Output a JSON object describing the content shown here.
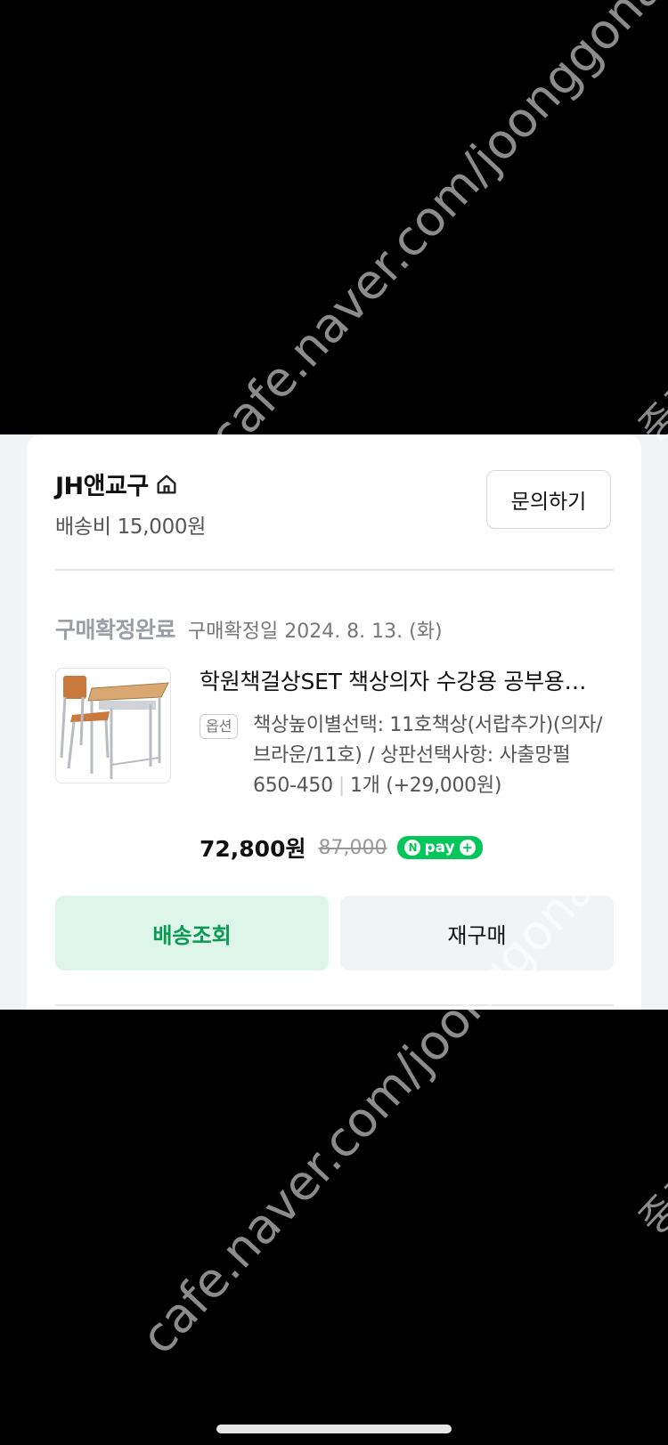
{
  "seller": {
    "name": "JH앤교구",
    "icon": "home-icon",
    "shipping_fee": "배송비 15,000원",
    "inquiry_label": "문의하기"
  },
  "order": {
    "status": "구매확정완료",
    "confirm_date": "구매확정일 2024. 8. 13. (화)"
  },
  "product": {
    "title": "학원책걸상SET 책상의자 수강용 공부용 책상 의자",
    "option_tag": "옵션",
    "option_text": "책상높이별선택: 11호책상(서랍추가)(의자/브라운/11호) / 상판선택사항: 사출망펄650-450",
    "quantity": "1개 (+29,000원)",
    "price": "72,800원",
    "original_price": "87,000",
    "npay_label": "pay"
  },
  "buttons": {
    "track": "배송조회",
    "rebuy": "재구매"
  },
  "watermark": {
    "text": "cafe.naver.com/joonggonara",
    "side_text": "중고"
  },
  "colors": {
    "status_gray": "#9a9da3",
    "track_bg": "#def6ea",
    "track_text": "#0b9a52",
    "npay_green": "#03c75a"
  }
}
